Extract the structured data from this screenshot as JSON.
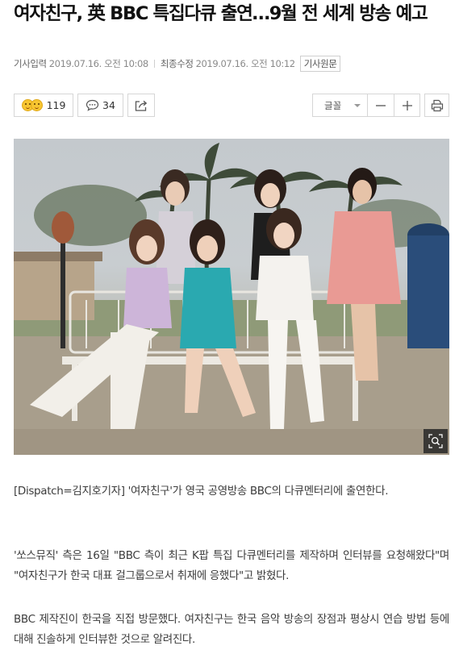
{
  "article": {
    "headline": "여자친구, 英 BBC 특집다큐 출연…9월 전 세계 방송 예고",
    "input_label": "기사입력",
    "input_time": "2019.07.16. 오전 10:08",
    "edit_label": "최종수정",
    "edit_time": "2019.07.16. 오전 10:12",
    "original_link": "기사원문"
  },
  "toolbar": {
    "reaction_count": "119",
    "comment_count": "34",
    "font_label": "글꼴",
    "icons": [
      "reaction-emoji-icon",
      "comment-icon",
      "share-icon",
      "caret-down-icon",
      "minus-icon",
      "plus-icon",
      "print-icon"
    ]
  },
  "photo": {
    "icons": [
      "zoom-icon"
    ],
    "colors": {
      "sky": "#c6cbcf",
      "ground": "#a59a88",
      "mailbox": "#2a4d7a"
    }
  },
  "body": {
    "p1": " [Dispatch=김지호기자] '여자친구'가 영국 공영방송 BBC의 다큐멘터리에 출연한다.",
    "p2": "'쏘스뮤직' 측은 16일 \"BBC 측이 최근 K팝 특집 다큐멘터리를 제작하며 인터뷰를 요청해왔다\"며 \"여자친구가 한국 대표 걸그룹으로서 취재에 응했다\"고 밝혔다.",
    "p3": "BBC 제작진이 한국을 직접 방문했다. 여자친구는 한국 음악 방송의 장점과 평상시 연습 방법 등에 대해 진솔하게 인터뷰한 것으로 알려진다."
  }
}
